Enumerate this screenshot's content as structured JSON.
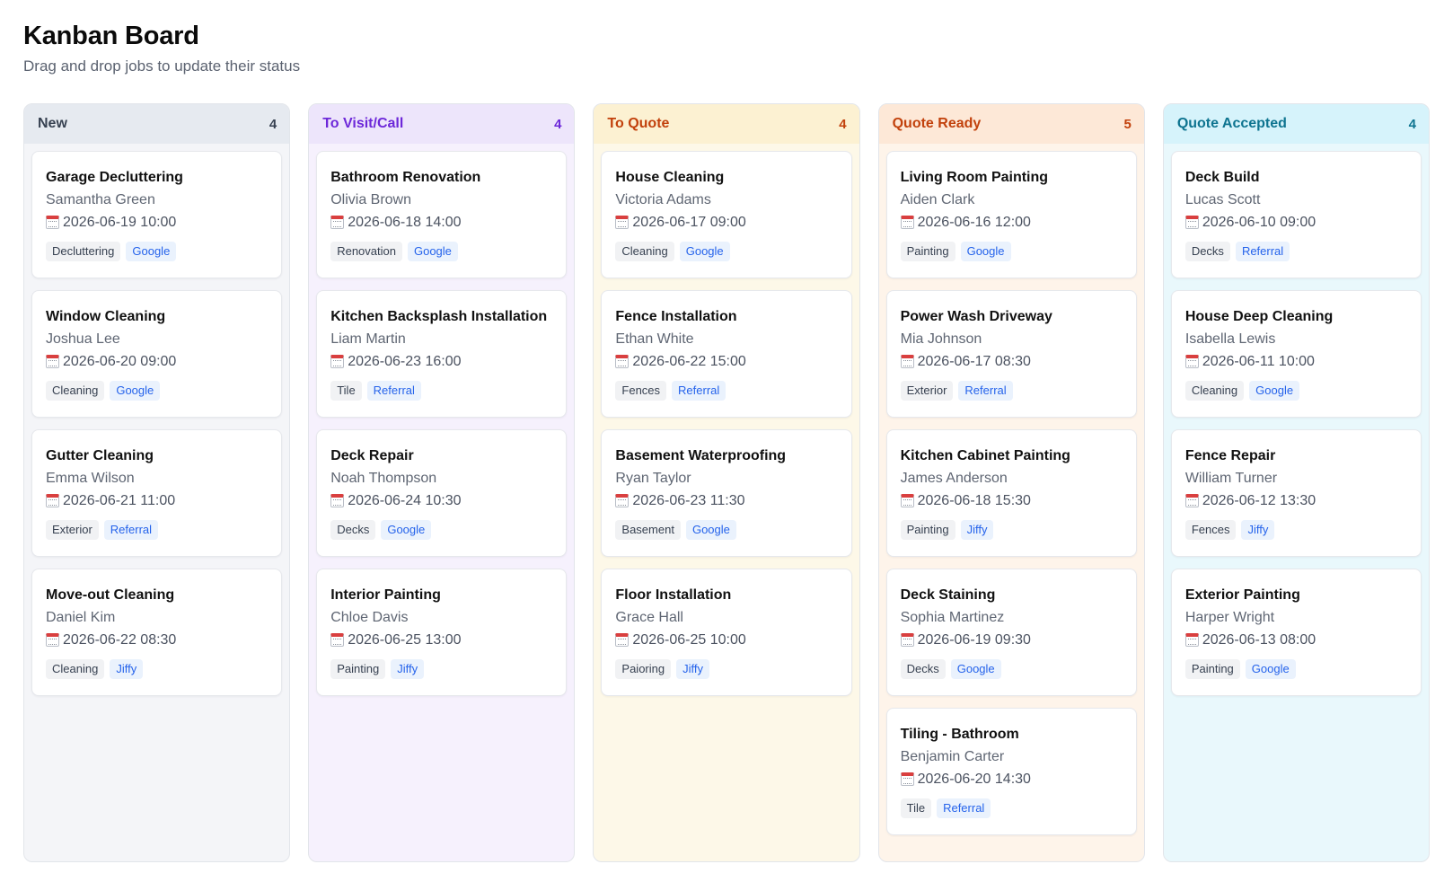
{
  "header": {
    "title": "Kanban Board",
    "subtitle": "Drag and drop jobs to update their status"
  },
  "columns": [
    {
      "name": "New",
      "count": "4",
      "colors": {
        "header_bg": "#e6eaf0",
        "header_text": "#374151",
        "body_bg": "#f4f5f8"
      },
      "cards": [
        {
          "title": "Garage Decluttering",
          "client": "Samantha Green",
          "date": "2026-06-19 10:00",
          "category": "Decluttering",
          "source": "Google"
        },
        {
          "title": "Window Cleaning",
          "client": "Joshua Lee",
          "date": "2026-06-20 09:00",
          "category": "Cleaning",
          "source": "Google"
        },
        {
          "title": "Gutter Cleaning",
          "client": "Emma Wilson",
          "date": "2026-06-21 11:00",
          "category": "Exterior",
          "source": "Referral"
        },
        {
          "title": "Move-out Cleaning",
          "client": "Daniel Kim",
          "date": "2026-06-22 08:30",
          "category": "Cleaning",
          "source": "Jiffy"
        }
      ]
    },
    {
      "name": "To Visit/Call",
      "count": "4",
      "colors": {
        "header_bg": "#ede5fb",
        "header_text": "#6d28d9",
        "body_bg": "#f6f1fd"
      },
      "cards": [
        {
          "title": "Bathroom Renovation",
          "client": "Olivia Brown",
          "date": "2026-06-18 14:00",
          "category": "Renovation",
          "source": "Google"
        },
        {
          "title": "Kitchen Backsplash Installation",
          "client": "Liam Martin",
          "date": "2026-06-23 16:00",
          "category": "Tile",
          "source": "Referral"
        },
        {
          "title": "Deck Repair",
          "client": "Noah Thompson",
          "date": "2026-06-24 10:30",
          "category": "Decks",
          "source": "Google"
        },
        {
          "title": "Interior Painting",
          "client": "Chloe Davis",
          "date": "2026-06-25 13:00",
          "category": "Painting",
          "source": "Jiffy"
        }
      ]
    },
    {
      "name": "To Quote",
      "count": "4",
      "colors": {
        "header_bg": "#fcf1d2",
        "header_text": "#c2410c",
        "body_bg": "#fdf8e8"
      },
      "cards": [
        {
          "title": "House Cleaning",
          "client": "Victoria Adams",
          "date": "2026-06-17 09:00",
          "category": "Cleaning",
          "source": "Google"
        },
        {
          "title": "Fence Installation",
          "client": "Ethan White",
          "date": "2026-06-22 15:00",
          "category": "Fences",
          "source": "Referral"
        },
        {
          "title": "Basement Waterproofing",
          "client": "Ryan Taylor",
          "date": "2026-06-23 11:30",
          "category": "Basement",
          "source": "Google"
        },
        {
          "title": "Floor Installation",
          "client": "Grace Hall",
          "date": "2026-06-25 10:00",
          "category": "Paioring",
          "source": "Jiffy"
        }
      ]
    },
    {
      "name": "Quote Ready",
      "count": "5",
      "colors": {
        "header_bg": "#fde8d7",
        "header_text": "#c2410c",
        "body_bg": "#fef4ea"
      },
      "cards": [
        {
          "title": "Living Room Painting",
          "client": "Aiden Clark",
          "date": "2026-06-16 12:00",
          "category": "Painting",
          "source": "Google"
        },
        {
          "title": "Power Wash Driveway",
          "client": "Mia Johnson",
          "date": "2026-06-17 08:30",
          "category": "Exterior",
          "source": "Referral"
        },
        {
          "title": "Kitchen Cabinet Painting",
          "client": "James Anderson",
          "date": "2026-06-18 15:30",
          "category": "Painting",
          "source": "Jiffy"
        },
        {
          "title": "Deck Staining",
          "client": "Sophia Martinez",
          "date": "2026-06-19 09:30",
          "category": "Decks",
          "source": "Google"
        },
        {
          "title": "Tiling - Bathroom",
          "client": "Benjamin Carter",
          "date": "2026-06-20 14:30",
          "category": "Tile",
          "source": "Referral"
        }
      ]
    },
    {
      "name": "Quote Accepted",
      "count": "4",
      "colors": {
        "header_bg": "#d6f3fb",
        "header_text": "#0e7490",
        "body_bg": "#e9f8fc"
      },
      "cards": [
        {
          "title": "Deck Build",
          "client": "Lucas Scott",
          "date": "2026-06-10 09:00",
          "category": "Decks",
          "source": "Referral"
        },
        {
          "title": "House Deep Cleaning",
          "client": "Isabella Lewis",
          "date": "2026-06-11 10:00",
          "category": "Cleaning",
          "source": "Google"
        },
        {
          "title": "Fence Repair",
          "client": "William Turner",
          "date": "2026-06-12 13:30",
          "category": "Fences",
          "source": "Jiffy"
        },
        {
          "title": "Exterior Painting",
          "client": "Harper Wright",
          "date": "2026-06-13 08:00",
          "category": "Painting",
          "source": "Google"
        }
      ]
    }
  ]
}
